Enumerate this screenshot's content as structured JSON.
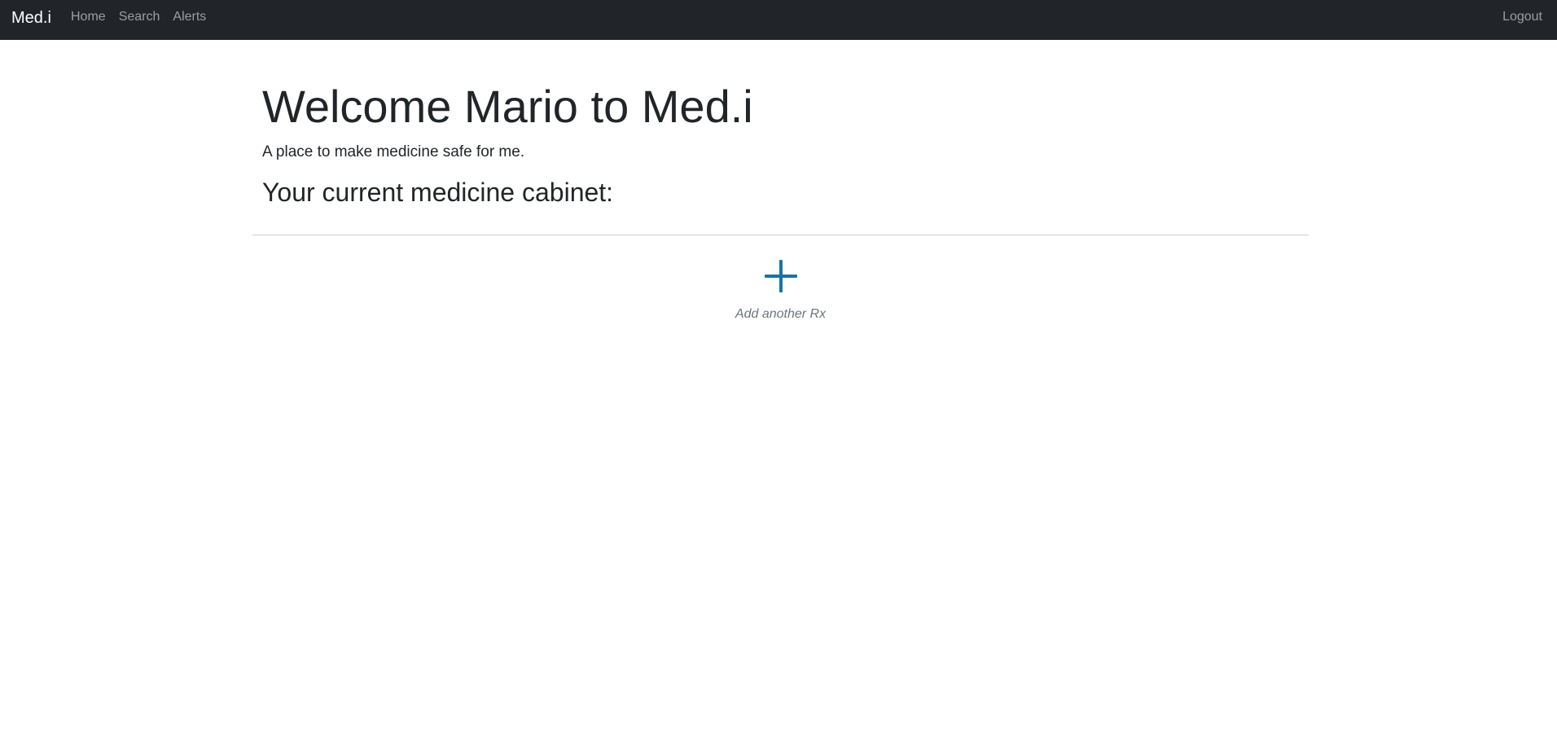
{
  "navbar": {
    "brand": "Med.i",
    "links": [
      {
        "label": "Home"
      },
      {
        "label": "Search"
      },
      {
        "label": "Alerts"
      }
    ],
    "logout": "Logout"
  },
  "main": {
    "welcome": "Welcome Mario to Med.i",
    "tagline": "A place to make medicine safe for me.",
    "cabinet_title": "Your current medicine cabinet:",
    "add_caption": "Add another Rx"
  },
  "colors": {
    "navbar_bg": "#212529",
    "accent": "#1b74a3",
    "muted": "#6c757d"
  },
  "icons": {
    "add": "plus-icon"
  }
}
